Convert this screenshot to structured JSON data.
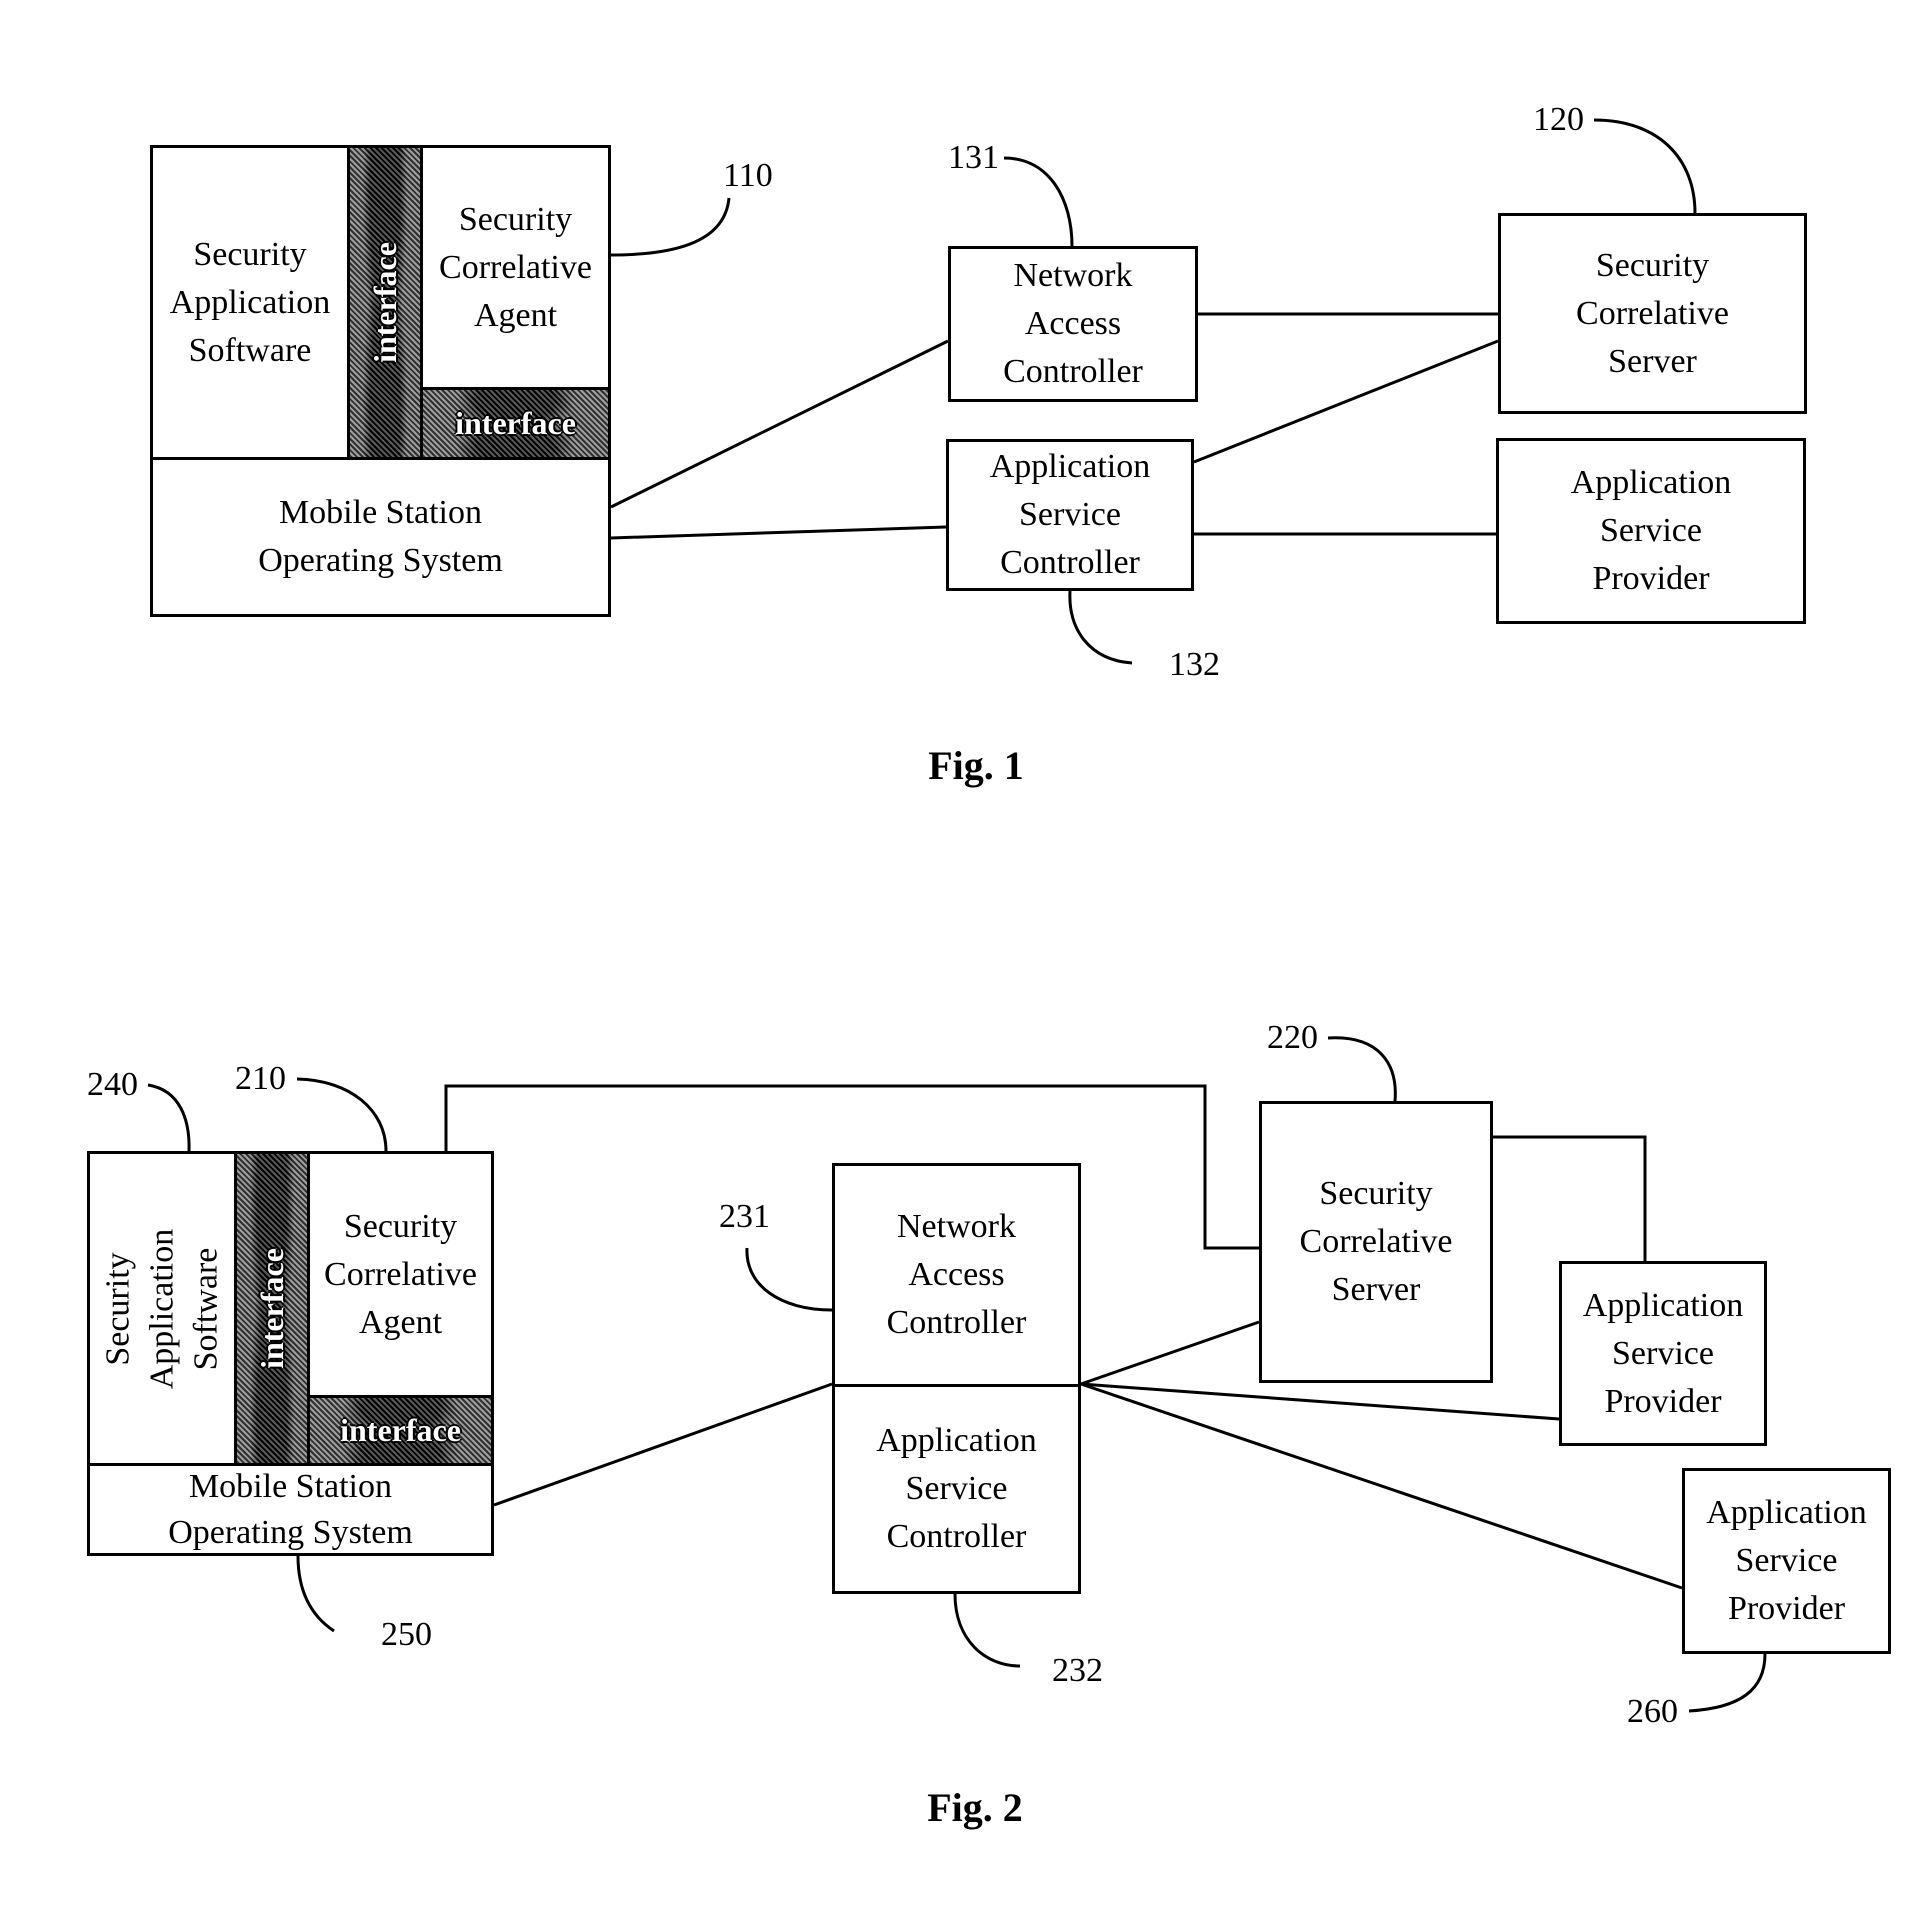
{
  "fig1": {
    "caption": "Fig. 1",
    "device": {
      "ref": "110",
      "security_app": "Security\nApplication\nSoftware",
      "interface_vertical": "interface",
      "agent": "Security\nCorrelative\nAgent",
      "interface_horizontal": "interface",
      "os": "Mobile Station\nOperating System"
    },
    "nac": {
      "label": "Network\nAccess\nController",
      "ref": "131"
    },
    "asc": {
      "label": "Application\nService\nController",
      "ref": "132"
    },
    "server": {
      "label": "Security\nCorrelative\nServer",
      "ref": "120"
    },
    "provider": {
      "label": "Application\nService\nProvider"
    }
  },
  "fig2": {
    "caption": "Fig. 2",
    "device": {
      "ref_agent": "210",
      "ref_app": "240",
      "ref_os": "250",
      "security_app": "Security\nApplication\nSoftware",
      "interface_vertical": "interface",
      "agent": "Security\nCorrelative\nAgent",
      "interface_horizontal": "interface",
      "os": "Mobile Station\nOperating System"
    },
    "nac": {
      "label": "Network\nAccess\nController",
      "ref": "231"
    },
    "asc": {
      "label": "Application\nService\nController",
      "ref": "232"
    },
    "server": {
      "label": "Security\nCorrelative\nServer",
      "ref": "220"
    },
    "provider1": {
      "label": "Application\nService\nProvider"
    },
    "provider2": {
      "label": "Application\nService\nProvider",
      "ref": "260"
    }
  }
}
